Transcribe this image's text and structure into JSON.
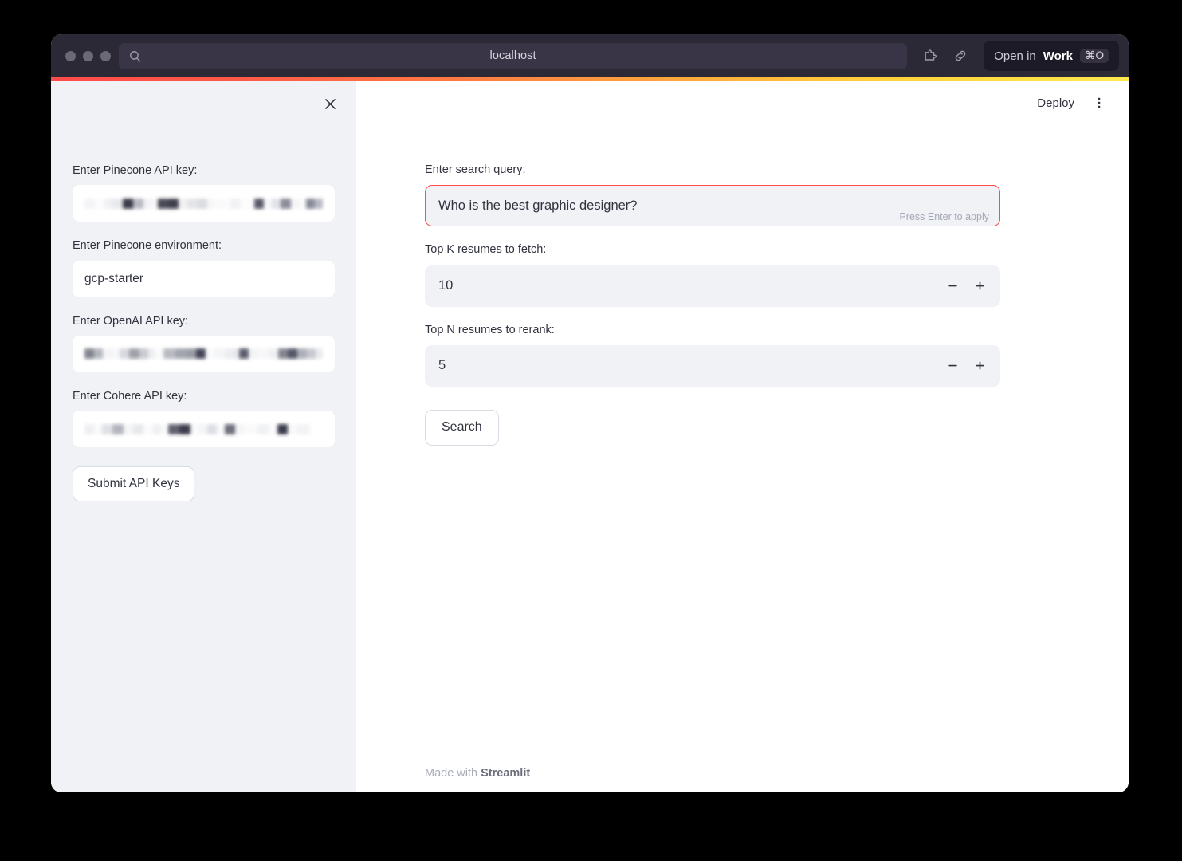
{
  "browser": {
    "url_title": "localhost",
    "search_icon": "search-icon",
    "extension_icon": "puzzle-piece-icon",
    "link_icon": "link-icon",
    "open_in_work": {
      "prefix": "Open in",
      "app": "Work",
      "shortcut": "⌘O"
    },
    "traffic_lights": [
      "close",
      "minimize",
      "maximize"
    ]
  },
  "app": {
    "accent_gradient_start": "#ff4b4b",
    "accent_gradient_end": "#ffe94f",
    "sidebar_bg": "#f0f2f6",
    "focus_color": "#ff4b4b"
  },
  "sidebar": {
    "close_icon": "close-icon",
    "fields": [
      {
        "label": "Enter Pinecone API key:",
        "value": "",
        "masked": true,
        "name": "pinecone-api-key"
      },
      {
        "label": "Enter Pinecone environment:",
        "value": "gcp-starter",
        "masked": false,
        "name": "pinecone-environment"
      },
      {
        "label": "Enter OpenAI API key:",
        "value": "",
        "masked": true,
        "name": "openai-api-key"
      },
      {
        "label": "Enter Cohere API key:",
        "value": "",
        "masked": true,
        "name": "cohere-api-key"
      }
    ],
    "submit_label": "Submit API Keys"
  },
  "topbar": {
    "deploy_label": "Deploy",
    "menu_icon": "kebab-menu-icon"
  },
  "main": {
    "search_query": {
      "label": "Enter search query:",
      "value": "Who is the best graphic designer?",
      "hint": "Press Enter to apply",
      "focused": true
    },
    "top_k": {
      "label": "Top K resumes to fetch:",
      "value": "10",
      "decrement_icon": "minus-icon",
      "increment_icon": "plus-icon"
    },
    "top_n": {
      "label": "Top N resumes to rerank:",
      "value": "5",
      "decrement_icon": "minus-icon",
      "increment_icon": "plus-icon"
    },
    "search_button": "Search"
  },
  "footer": {
    "made_with": "Made with ",
    "brand": "Streamlit"
  }
}
